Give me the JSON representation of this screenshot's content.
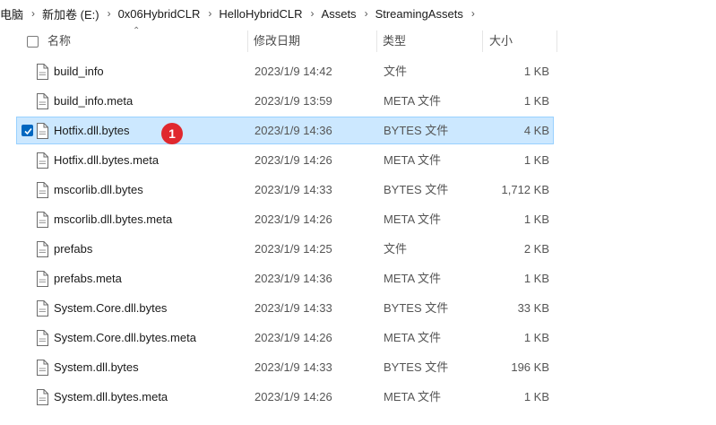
{
  "breadcrumb": [
    "电脑",
    "新加卷 (E:)",
    "0x06HybridCLR",
    "HelloHybridCLR",
    "Assets",
    "StreamingAssets"
  ],
  "columns": {
    "name": "名称",
    "date": "修改日期",
    "type": "类型",
    "size": "大小"
  },
  "files": [
    {
      "name": "build_info",
      "date": "2023/1/9 14:42",
      "type": "文件",
      "size": "1 KB",
      "selected": false
    },
    {
      "name": "build_info.meta",
      "date": "2023/1/9 13:59",
      "type": "META 文件",
      "size": "1 KB",
      "selected": false
    },
    {
      "name": "Hotfix.dll.bytes",
      "date": "2023/1/9 14:36",
      "type": "BYTES 文件",
      "size": "4 KB",
      "selected": true
    },
    {
      "name": "Hotfix.dll.bytes.meta",
      "date": "2023/1/9 14:26",
      "type": "META 文件",
      "size": "1 KB",
      "selected": false
    },
    {
      "name": "mscorlib.dll.bytes",
      "date": "2023/1/9 14:33",
      "type": "BYTES 文件",
      "size": "1,712 KB",
      "selected": false
    },
    {
      "name": "mscorlib.dll.bytes.meta",
      "date": "2023/1/9 14:26",
      "type": "META 文件",
      "size": "1 KB",
      "selected": false
    },
    {
      "name": "prefabs",
      "date": "2023/1/9 14:25",
      "type": "文件",
      "size": "2 KB",
      "selected": false
    },
    {
      "name": "prefabs.meta",
      "date": "2023/1/9 14:36",
      "type": "META 文件",
      "size": "1 KB",
      "selected": false
    },
    {
      "name": "System.Core.dll.bytes",
      "date": "2023/1/9 14:33",
      "type": "BYTES 文件",
      "size": "33 KB",
      "selected": false
    },
    {
      "name": "System.Core.dll.bytes.meta",
      "date": "2023/1/9 14:26",
      "type": "META 文件",
      "size": "1 KB",
      "selected": false
    },
    {
      "name": "System.dll.bytes",
      "date": "2023/1/9 14:33",
      "type": "BYTES 文件",
      "size": "196 KB",
      "selected": false
    },
    {
      "name": "System.dll.bytes.meta",
      "date": "2023/1/9 14:26",
      "type": "META 文件",
      "size": "1 KB",
      "selected": false
    }
  ],
  "annotation": {
    "label": "1",
    "color": "#e0282e"
  },
  "icons": {
    "file": "document-icon",
    "separator": "chevron-right-icon",
    "check": "checkmark-icon",
    "sort": "chevron-up-icon"
  },
  "colors": {
    "selection_bg": "#cce8ff",
    "selection_border": "#99d1ff",
    "checkbox_blue": "#0067c0"
  }
}
